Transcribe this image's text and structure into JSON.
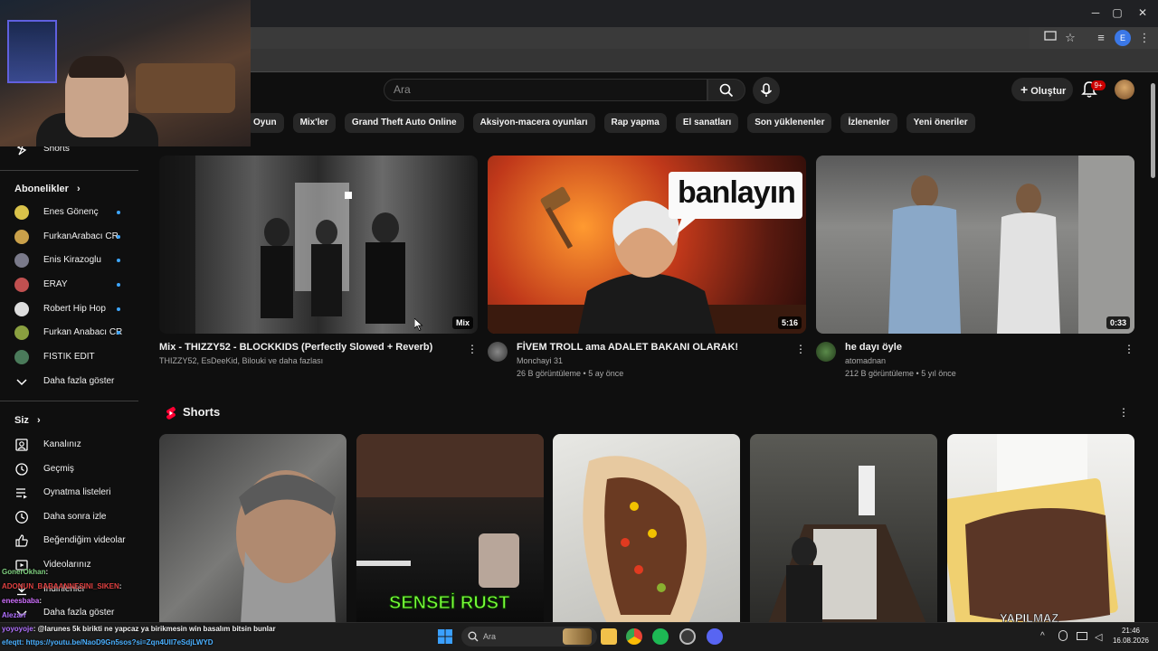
{
  "browser": {
    "window_controls": [
      "─",
      "▢",
      "✕"
    ],
    "profile_initial": "E"
  },
  "header": {
    "search_placeholder": "Ara",
    "create_label": "Oluştur",
    "notification_count": "9+"
  },
  "chips": [
    "Oyun",
    "Mix'ler",
    "Grand Theft Auto Online",
    "Aksiyon-macera oyunları",
    "Rap yapma",
    "El sanatları",
    "Son yüklenenler",
    "İzlenenler",
    "Yeni öneriler"
  ],
  "sidebar": {
    "shorts_label": "Shorts",
    "subscriptions_heading": "Abonelikler",
    "subscriptions": [
      {
        "name": "Enes Gönenç",
        "color": "#d9c24a"
      },
      {
        "name": "FurkanArabacı CR",
        "color": "#c9a04a"
      },
      {
        "name": "Enis Kirazoglu",
        "color": "#7a7a8a"
      },
      {
        "name": "ERAY",
        "color": "#c05050"
      },
      {
        "name": "Robert Hip Hop",
        "color": "#dddddd"
      },
      {
        "name": "Furkan Anabacı CR",
        "color": "#8aa040"
      },
      {
        "name": "FISTIK EDIT",
        "color": "#4a7a5a"
      }
    ],
    "show_more": "Daha fazla göster",
    "you_heading": "Siz",
    "you_items": [
      {
        "label": "Kanalınız",
        "icon": "channel-icon"
      },
      {
        "label": "Geçmiş",
        "icon": "history-icon"
      },
      {
        "label": "Oynatma listeleri",
        "icon": "playlist-icon"
      },
      {
        "label": "Daha sonra izle",
        "icon": "watch-later-icon"
      },
      {
        "label": "Beğendiğim videolar",
        "icon": "like-icon"
      },
      {
        "label": "Videolarınız",
        "icon": "your-videos-icon"
      },
      {
        "label": "İndirilenler",
        "icon": "download-icon"
      },
      {
        "label": "Daha fazla göster",
        "icon": "chevron-down-icon"
      }
    ]
  },
  "videos": [
    {
      "title": "Mix - THIZZY52 - BLOCKKIDS (Perfectly Slowed + Reverb)",
      "channel": "THIZZY52, EsDeeKid, Bilouki ve daha fazlası",
      "stats": "",
      "badge": "Mix"
    },
    {
      "title": "FİVEM TROLL ama ADALET BAKANI OLARAK!",
      "channel": "Monchayi 31",
      "stats": "26 B görüntüleme • 5 ay önce",
      "badge": "5:16",
      "thumb_text": "banlayın"
    },
    {
      "title": "he dayı öyle",
      "channel": "atomadnan",
      "stats": "212 B görüntüleme • 5 yıl önce",
      "badge": "0:33"
    }
  ],
  "shorts_section": {
    "heading": "Shorts",
    "overlay_texts": [
      "SENSEİ RUST",
      "YAPILMAZ"
    ]
  },
  "chat": [
    {
      "user": "GonerOkhan",
      "text": ":",
      "color": "#7fd07f"
    },
    {
      "user": "ADONUN_BABAANNESINI_SIKEN",
      "text": ":",
      "color": "#e04040"
    },
    {
      "user": "eneesbaba",
      "text": ":",
      "color": "#d070ff"
    },
    {
      "user": "Alezarr",
      "text": "",
      "color": "#b070ff"
    },
    {
      "user": "yoyoyoje",
      "text": ": @larunes 5k birikti ne yapcaz ya birikmesin win basalım bitsin bunlar",
      "color": "#b070ff"
    },
    {
      "user": "efeqtt",
      "text": ": https://youtu.be/NaoD9Gn5sos?si=Zqn4UII7eSdjLWYD",
      "color": "#4ab0ff"
    }
  ],
  "taskbar": {
    "search_placeholder": "Ara",
    "time": "21:46",
    "date": "16.08.2026"
  }
}
